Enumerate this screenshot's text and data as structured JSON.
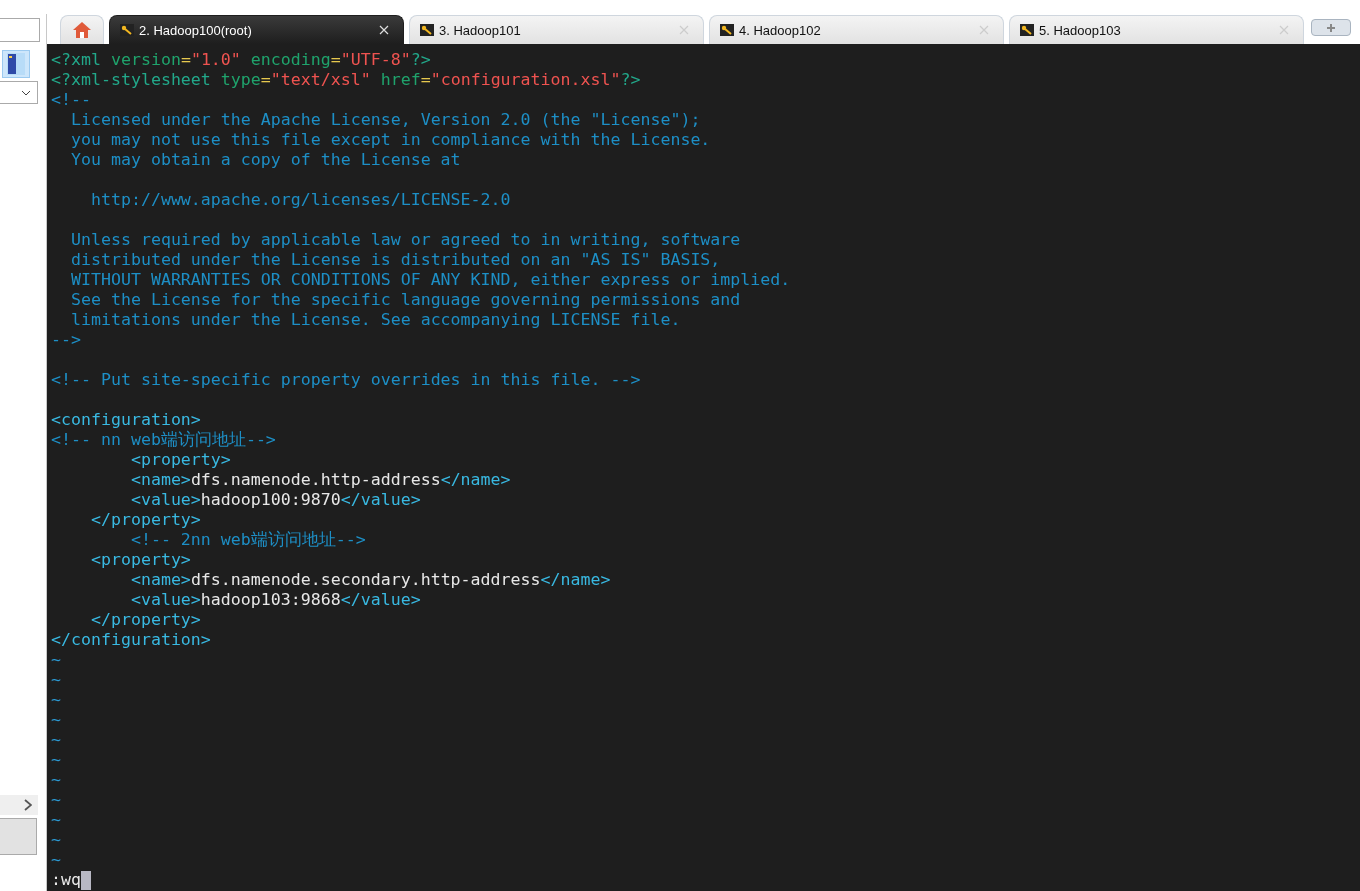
{
  "tabs": [
    {
      "kind": "home",
      "selected": false
    },
    {
      "kind": "session",
      "label": "2. Hadoop100(root)",
      "selected": true
    },
    {
      "kind": "session",
      "label": "3. Hadoop101",
      "selected": false
    },
    {
      "kind": "session",
      "label": "4. Hadoop102",
      "selected": false
    },
    {
      "kind": "session",
      "label": "5. Hadoop103",
      "selected": false
    }
  ],
  "terminal": {
    "lines": [
      {
        "segments": [
          {
            "kind": "pi",
            "text": "<?xml "
          },
          {
            "kind": "attr",
            "text": "version"
          },
          {
            "kind": "eq",
            "text": "="
          },
          {
            "kind": "str",
            "text": "\"1.0\" "
          },
          {
            "kind": "attr",
            "text": "encoding"
          },
          {
            "kind": "eq",
            "text": "="
          },
          {
            "kind": "str",
            "text": "\"UTF-8\""
          },
          {
            "kind": "pi",
            "text": "?>"
          }
        ]
      },
      {
        "segments": [
          {
            "kind": "pi",
            "text": "<?xml-stylesheet "
          },
          {
            "kind": "attr",
            "text": "type"
          },
          {
            "kind": "eq",
            "text": "="
          },
          {
            "kind": "str",
            "text": "\"text/xsl\" "
          },
          {
            "kind": "attr",
            "text": "href"
          },
          {
            "kind": "eq",
            "text": "="
          },
          {
            "kind": "str",
            "text": "\"configuration.xsl\""
          },
          {
            "kind": "pi",
            "text": "?>"
          }
        ]
      },
      {
        "segments": [
          {
            "kind": "comment",
            "text": "<!--"
          }
        ]
      },
      {
        "segments": [
          {
            "kind": "comment",
            "text": "  Licensed under the Apache License, Version 2.0 (the \"License\");"
          }
        ]
      },
      {
        "segments": [
          {
            "kind": "comment",
            "text": "  you may not use this file except in compliance with the License."
          }
        ]
      },
      {
        "segments": [
          {
            "kind": "comment",
            "text": "  You may obtain a copy of the License at"
          }
        ]
      },
      {
        "kind": "blank"
      },
      {
        "segments": [
          {
            "kind": "comment",
            "text": "    http://www.apache.org/licenses/LICENSE-2.0"
          }
        ]
      },
      {
        "kind": "blank"
      },
      {
        "segments": [
          {
            "kind": "comment",
            "text": "  Unless required by applicable law or agreed to in writing, software"
          }
        ]
      },
      {
        "segments": [
          {
            "kind": "comment",
            "text": "  distributed under the License is distributed on an \"AS IS\" BASIS,"
          }
        ]
      },
      {
        "segments": [
          {
            "kind": "comment",
            "text": "  WITHOUT WARRANTIES OR CONDITIONS OF ANY KIND, either express or implied."
          }
        ]
      },
      {
        "segments": [
          {
            "kind": "comment",
            "text": "  See the License for the specific language governing permissions and"
          }
        ]
      },
      {
        "segments": [
          {
            "kind": "comment",
            "text": "  limitations under the License. See accompanying LICENSE file."
          }
        ]
      },
      {
        "segments": [
          {
            "kind": "comment",
            "text": "-->"
          }
        ]
      },
      {
        "kind": "blank"
      },
      {
        "segments": [
          {
            "kind": "comment",
            "text": "<!-- Put site-specific property overrides in this file. -->"
          }
        ]
      },
      {
        "kind": "blank"
      },
      {
        "segments": [
          {
            "kind": "tag",
            "text": "<configuration>"
          }
        ]
      },
      {
        "segments": [
          {
            "kind": "comment",
            "text": "<!-- nn web端访问地址-->"
          }
        ]
      },
      {
        "segments": [
          {
            "kind": "tag",
            "text": "        <property>"
          }
        ]
      },
      {
        "segments": [
          {
            "kind": "tag",
            "text": "        <name>"
          },
          {
            "kind": "text",
            "text": "dfs.namenode.http-address"
          },
          {
            "kind": "tag",
            "text": "</name>"
          }
        ]
      },
      {
        "segments": [
          {
            "kind": "tag",
            "text": "        <value>"
          },
          {
            "kind": "text",
            "text": "hadoop100:9870"
          },
          {
            "kind": "tag",
            "text": "</value>"
          }
        ]
      },
      {
        "segments": [
          {
            "kind": "tag",
            "text": "    </property>"
          }
        ]
      },
      {
        "segments": [
          {
            "kind": "comment",
            "text": "        <!-- 2nn web端访问地址-->"
          }
        ]
      },
      {
        "segments": [
          {
            "kind": "tag",
            "text": "    <property>"
          }
        ]
      },
      {
        "segments": [
          {
            "kind": "tag",
            "text": "        <name>"
          },
          {
            "kind": "text",
            "text": "dfs.namenode.secondary.http-address"
          },
          {
            "kind": "tag",
            "text": "</name>"
          }
        ]
      },
      {
        "segments": [
          {
            "kind": "tag",
            "text": "        <value>"
          },
          {
            "kind": "text",
            "text": "hadoop103:9868"
          },
          {
            "kind": "tag",
            "text": "</value>"
          }
        ]
      },
      {
        "segments": [
          {
            "kind": "tag",
            "text": "    </property>"
          }
        ]
      },
      {
        "segments": [
          {
            "kind": "tag",
            "text": "</configuration>"
          }
        ]
      },
      {
        "segments": [
          {
            "kind": "tilde",
            "text": "~"
          }
        ]
      },
      {
        "segments": [
          {
            "kind": "tilde",
            "text": "~"
          }
        ]
      },
      {
        "segments": [
          {
            "kind": "tilde",
            "text": "~"
          }
        ]
      },
      {
        "segments": [
          {
            "kind": "tilde",
            "text": "~"
          }
        ]
      },
      {
        "segments": [
          {
            "kind": "tilde",
            "text": "~"
          }
        ]
      },
      {
        "segments": [
          {
            "kind": "tilde",
            "text": "~"
          }
        ]
      },
      {
        "segments": [
          {
            "kind": "tilde",
            "text": "~"
          }
        ]
      },
      {
        "segments": [
          {
            "kind": "tilde",
            "text": "~"
          }
        ]
      },
      {
        "segments": [
          {
            "kind": "tilde",
            "text": "~"
          }
        ]
      },
      {
        "segments": [
          {
            "kind": "tilde",
            "text": "~"
          }
        ]
      },
      {
        "segments": [
          {
            "kind": "tilde",
            "text": "~"
          }
        ]
      }
    ],
    "command": ":wq"
  }
}
